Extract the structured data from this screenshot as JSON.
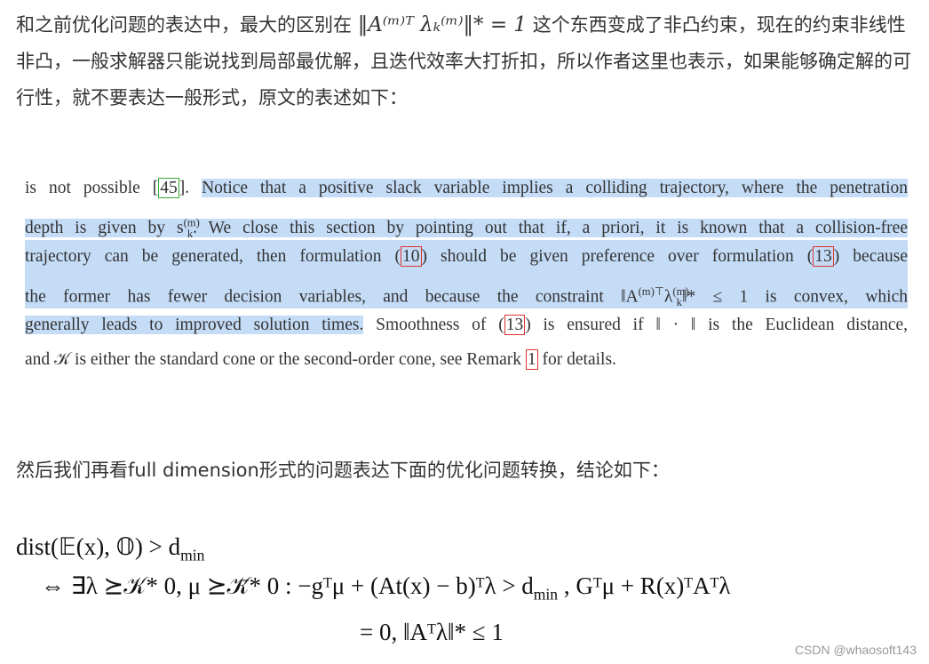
{
  "intro": {
    "before": "和之前优化问题的表达中，最大的区别在",
    "math": "‖A⁽ᵐ⁾ᵀ λₖ⁽ᵐ⁾‖* = 1",
    "after": "这个东西变成了非凸约束，现在的约束非线性非凸，一般求解器只能说找到局部最优解，且迭代效率大打折扣，所以作者这里也表示，如果能够确定解的可行性，就不要表达一般形式，原文的表述如下："
  },
  "excerpt": {
    "l1_a": "is not possible ",
    "ref45": "45",
    "l1_b": ". ",
    "l1_hl": "Notice that a positive slack variable implies a colliding trajectory, where the penetration",
    "l2_hl": "depth is given by s",
    "l2_sup": "(m)",
    "l2_sub": "k",
    "l2_hl2": ". We close this section by pointing out that if, a priori, it is known that a collision-free",
    "l3_a": "trajectory can be generated, then formulation ",
    "ref10": "10",
    "l3_b": " should be given preference over formulation ",
    "ref13": "13",
    "l3_c": " because",
    "l4_a": "the former has fewer decision variables, and because the constraint ‖A",
    "l4_sup1": "(m)⊤",
    "l4_b": "λ",
    "l4_sup2": "(m)",
    "l4_sub2": "k",
    "l4_c": "‖* ≤ 1 is convex, which",
    "l5_hl": "generally leads to improved solution times.",
    "l5_a": " Smoothness of ",
    "ref13b": "13",
    "l5_b": " is ensured if ‖ · ‖ is the Euclidean distance,",
    "l6_a": "and 𝒦 is either the standard cone or the second-order cone, see Remark ",
    "ref1": "1",
    "l6_b": " for details."
  },
  "para2": "然后我们再看full dimension形式的问题表达下面的优化问题转换，结论如下：",
  "equation": {
    "line1": "dist(𝔼(x), 𝕆) > d",
    "line1_sub": "min",
    "line2": "⇔ ∃λ ⪰𝒦* 0, μ ⪰𝒦̄* 0 : −gᵀμ + (At(x) − b)ᵀλ > d",
    "line2_sub": "min",
    "line2_b": " , Gᵀμ + R(x)ᵀAᵀλ",
    "line3": "= 0, ‖Aᵀλ‖* ≤ 1"
  },
  "watermark": "CSDN @whaosoft143"
}
